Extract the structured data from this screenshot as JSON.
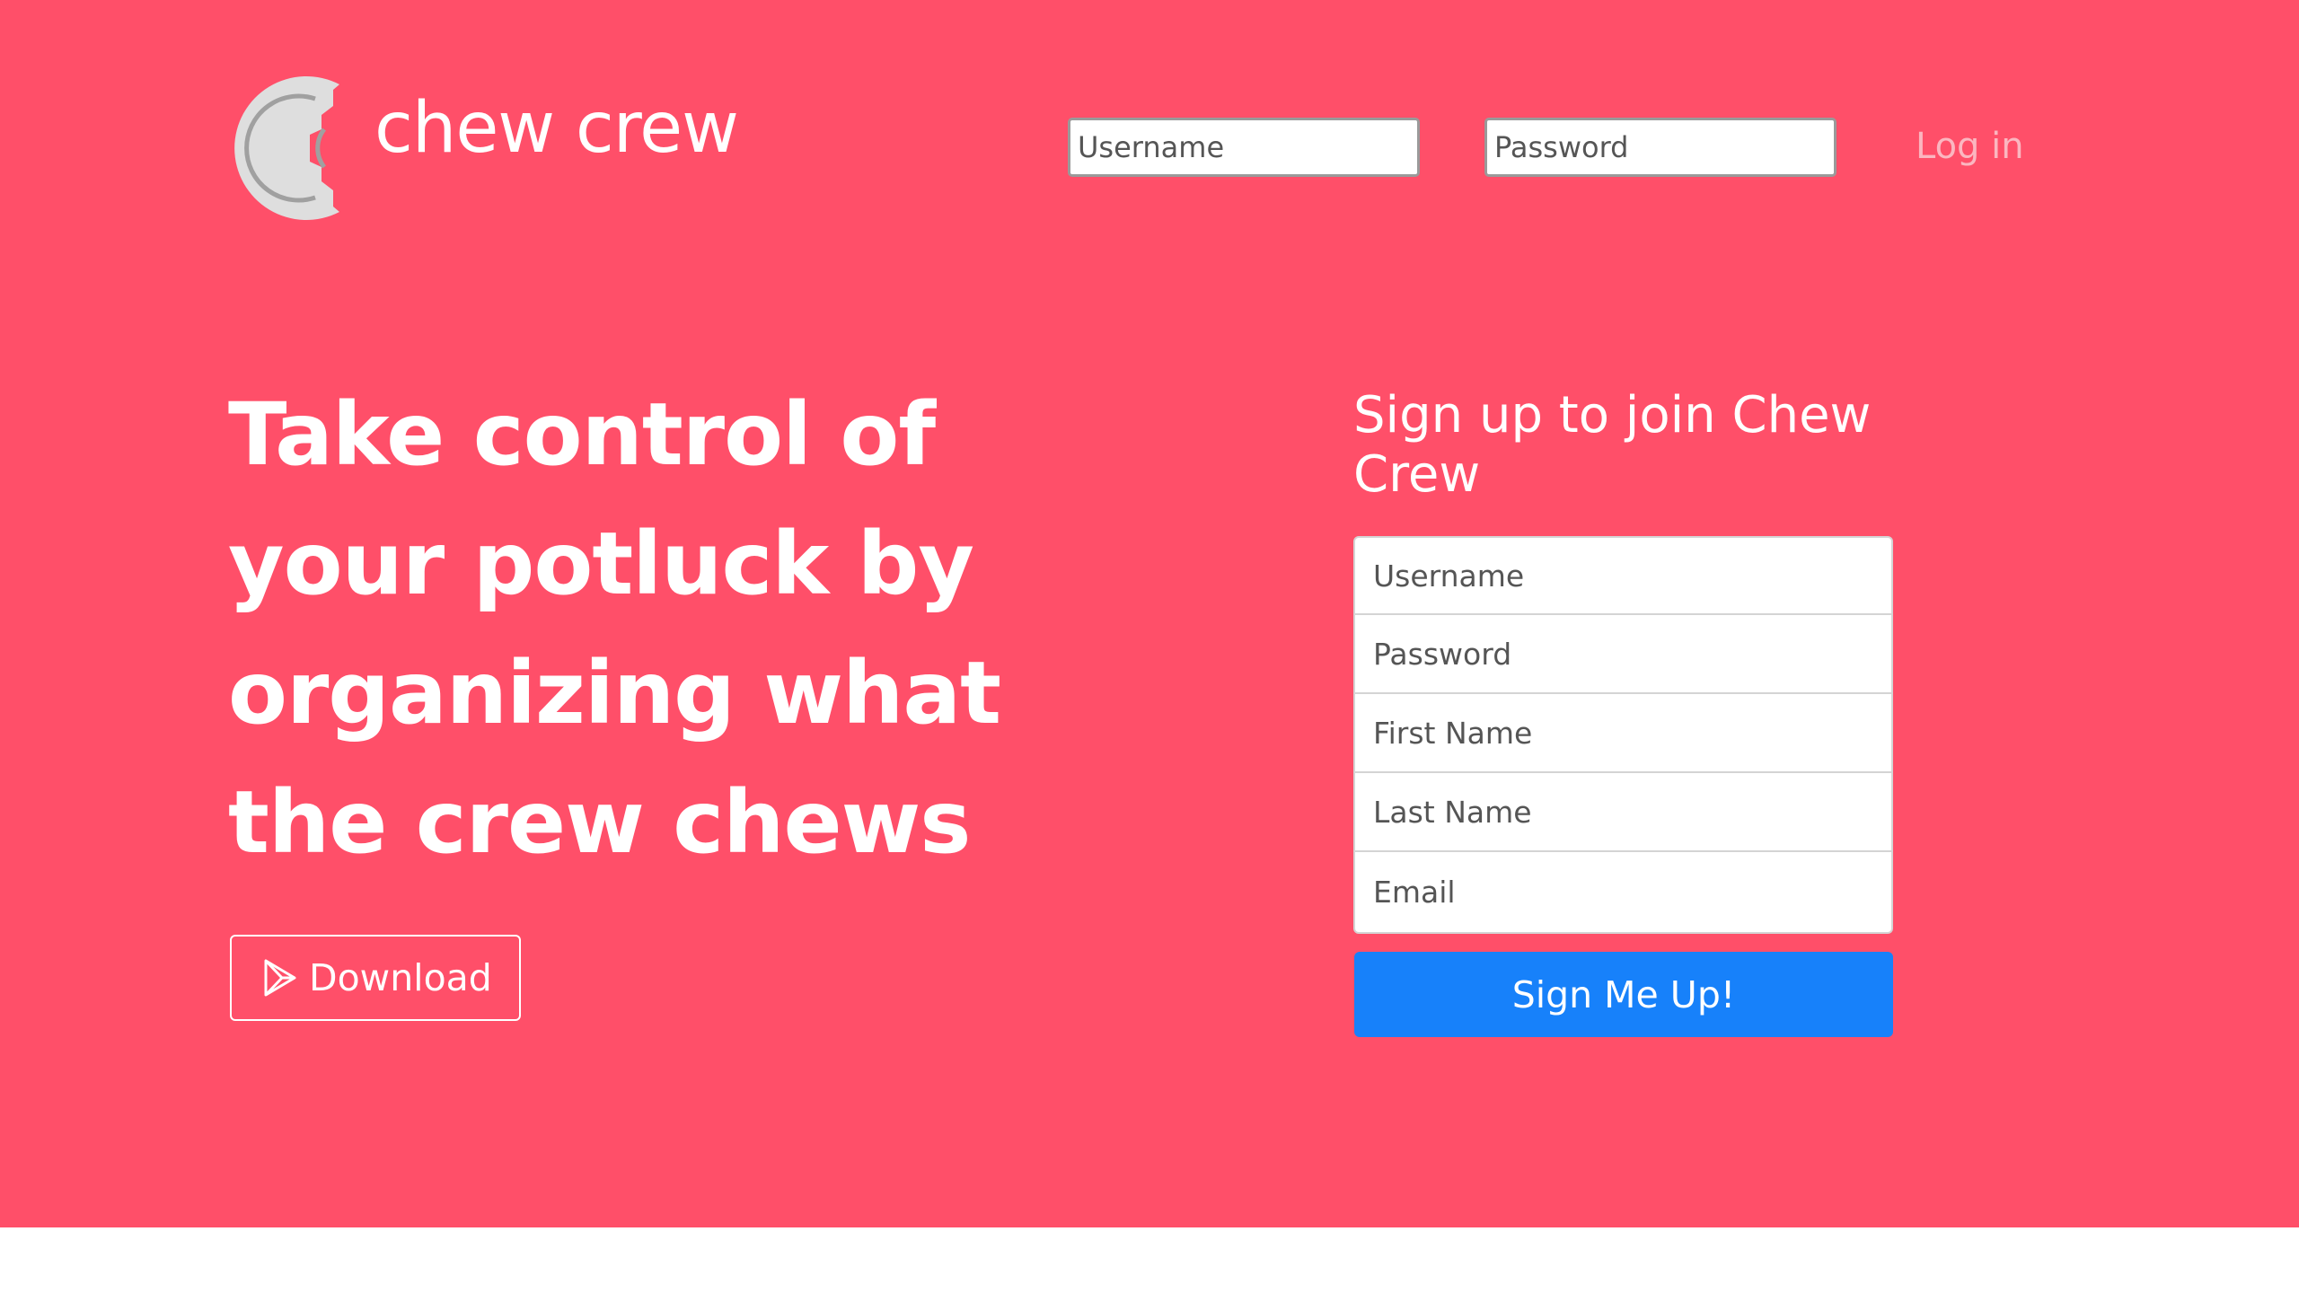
{
  "brand": {
    "name": "chew crew",
    "logo_icon": "bitten-cookie-logo"
  },
  "header": {
    "username_placeholder": "Username",
    "password_placeholder": "Password",
    "login_label": "Log in"
  },
  "hero": {
    "headline": "Take control of your potluck by organizing what the crew chews",
    "download_label": "Download",
    "download_icon": "play-store-icon"
  },
  "signup": {
    "title": "Sign up to join Chew Crew",
    "username_placeholder": "Username",
    "password_placeholder": "Password",
    "first_name_placeholder": "First Name",
    "last_name_placeholder": "Last Name",
    "email_placeholder": "Email",
    "submit_label": "Sign Me Up!"
  },
  "colors": {
    "background": "#ff4f69",
    "primary_button": "#1781fa",
    "login_link": "#fbb6c0",
    "text": "#ffffff"
  }
}
